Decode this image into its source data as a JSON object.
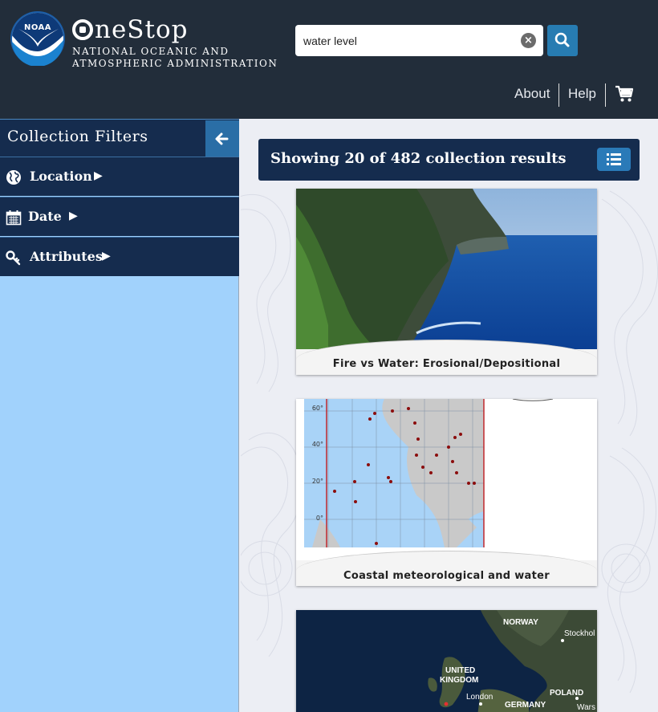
{
  "header": {
    "logo_text": "NOAA",
    "brand_title": "neStop",
    "brand_sub_line1": "NATIONAL OCEANIC AND",
    "brand_sub_line2": "ATMOSPHERIC ADMINISTRATION",
    "search": {
      "value": "water level",
      "placeholder": ""
    },
    "nav": {
      "about": "About",
      "help": "Help"
    }
  },
  "sidebar": {
    "title": "Collection Filters",
    "items": [
      {
        "label": "Location",
        "icon": "globe-icon"
      },
      {
        "label": "Date",
        "icon": "calendar-icon"
      },
      {
        "label": "Attributes",
        "icon": "key-icon"
      }
    ]
  },
  "results": {
    "summary": "Showing 20 of 482 collection results",
    "cards": [
      {
        "title": "Fire vs Water: Erosional/Depositional"
      },
      {
        "title": "Coastal meteorological and water"
      },
      {
        "title": ""
      }
    ],
    "map1_labels": [
      "60°",
      "40°",
      "20°",
      "0°"
    ],
    "map2_labels": [
      "NORWAY",
      "Stockhol",
      "UNITED",
      "KINGDOM",
      "London",
      "POLAND",
      "GERMANY",
      "Wars"
    ]
  },
  "colors": {
    "header_bg": "#222d3a",
    "panel_bg": "#152c4e",
    "accent": "#277cb2",
    "sidebar_bg": "#a1d2fc"
  }
}
